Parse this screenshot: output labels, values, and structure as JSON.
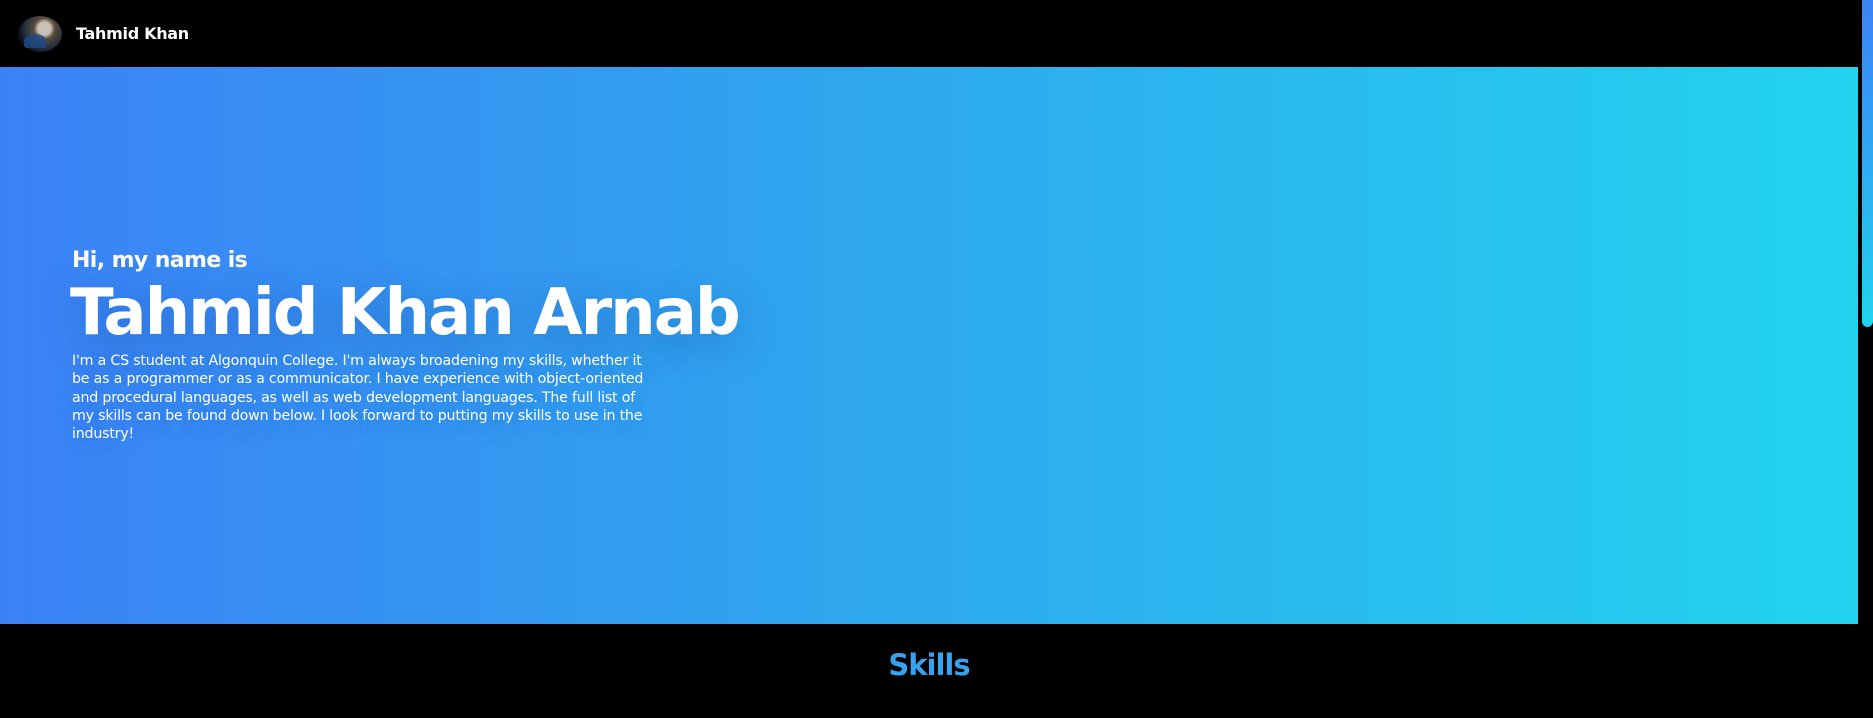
{
  "navbar": {
    "brand_name": "Tahmid Khan",
    "avatar_icon": "profile-photo-icon"
  },
  "hero": {
    "greeting": "Hi, my name is",
    "name": "Tahmid Khan Arnab",
    "bio": "I'm a CS student at Algonquin College. I'm always broadening my skills, whether it be as a programmer or as a communicator. I have experience with object-oriented and procedural languages, as well as web development languages. The full list of my skills can be found down below. I look forward to putting my skills to use in the industry!",
    "gradient_start": "#3b82f6",
    "gradient_end": "#22d3ee"
  },
  "skills": {
    "title": "Skills",
    "title_color": "#36a3f0"
  }
}
